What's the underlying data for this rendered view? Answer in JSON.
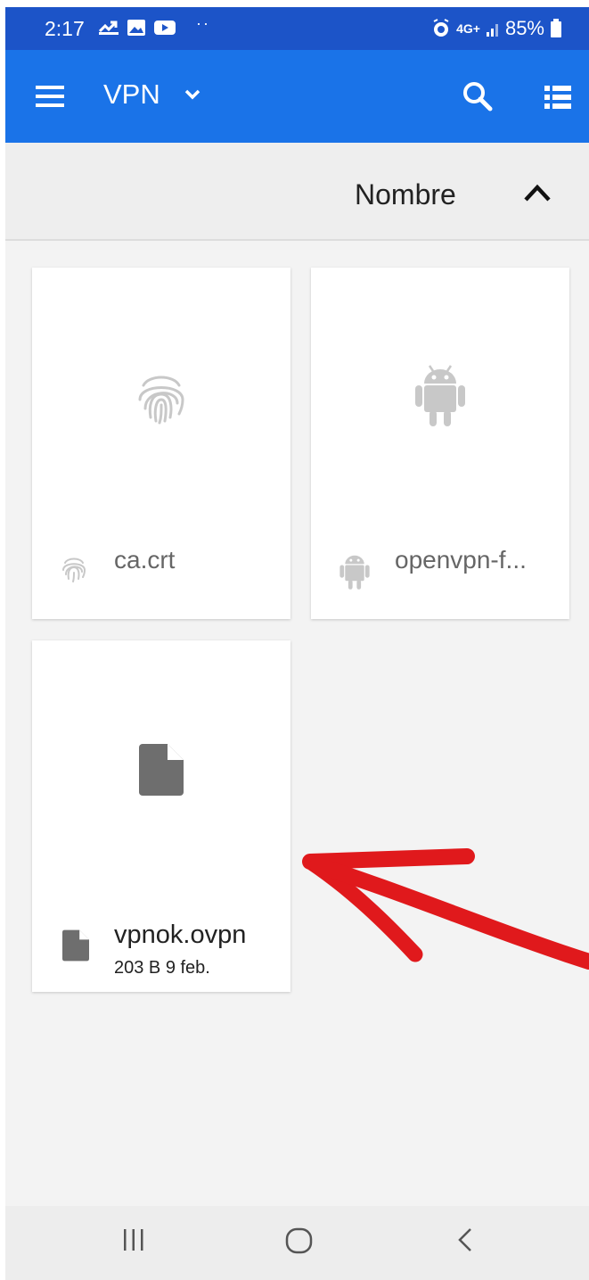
{
  "status_bar": {
    "time": "2:17",
    "battery": "85%",
    "network": "4G+",
    "icons": [
      "missed-call-icon",
      "image-icon",
      "youtube-icon",
      "alarm-icon",
      "signal-icon",
      "battery-icon"
    ]
  },
  "app_bar": {
    "title": "VPN",
    "icons": [
      "menu-icon",
      "chevron-down-icon",
      "search-icon",
      "list-view-icon"
    ],
    "color": "#1a73e8"
  },
  "sort": {
    "label": "Nombre",
    "direction_icon": "chevron-up-icon"
  },
  "files": [
    {
      "name": "ca.crt",
      "meta": "",
      "icon": "fingerprint-icon"
    },
    {
      "name": "openvpn-f...",
      "meta": "",
      "icon": "android-icon"
    },
    {
      "name": "vpnok.ovpn",
      "meta": "203 B 9 feb.",
      "icon": "file-icon"
    }
  ],
  "annotation": {
    "type": "red-arrow",
    "color": "#e0191c"
  },
  "nav_bar": {
    "icons": [
      "recents-icon",
      "home-icon",
      "back-icon"
    ]
  }
}
